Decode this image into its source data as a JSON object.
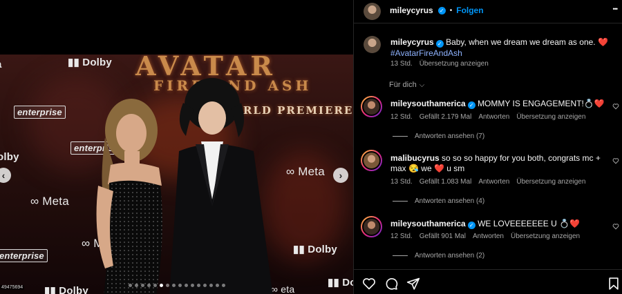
{
  "media": {
    "watermarks": {
      "dolby": "Dolby",
      "meta": "Meta",
      "enterprise": "enterprise",
      "premiere_line1": "AVATAR",
      "premiere_line2": "FIRE AND ASH",
      "premiere_line3": "WORLD PREMIERE"
    },
    "photo_id": "49475694",
    "carousel": {
      "total": 16,
      "active_index": 5
    },
    "prev_label": "‹",
    "next_label": "›"
  },
  "header": {
    "username": "mileycyrus",
    "follow_label": "Folgen",
    "separator": "•",
    "more_label": "•••"
  },
  "caption": {
    "username": "mileycyrus",
    "text": "Baby, when we dream we dream as one.",
    "emoji": "❤️",
    "hashtag": "#AvatarFireAndAsh",
    "time": "13 Std.",
    "translate": "Übersetzung anzeigen"
  },
  "sort": {
    "label": "Für dich",
    "chevron": "⌵"
  },
  "comments": [
    {
      "username": "mileysouthamerica",
      "text": "MOMMY IS ENGAGEMENT!💍❤️",
      "time": "12 Std.",
      "likes": "Gefällt 2.179 Mal",
      "reply": "Antworten",
      "translate": "Übersetzung anzeigen",
      "view_replies": "Antworten ansehen (7)"
    },
    {
      "username": "malibucyrus",
      "text": "so so so happy for you both, congrats mc + max 😪 we ❤️ u sm",
      "time": "13 Std.",
      "likes": "Gefällt 1.083 Mal",
      "reply": "Antworten",
      "translate": "Übersetzung anzeigen",
      "view_replies": "Antworten ansehen (4)"
    },
    {
      "username": "mileysouthamerica",
      "text": "WE LOVEEEEEEE U 💍❤️",
      "time": "12 Std.",
      "likes": "Gefällt 901 Mal",
      "reply": "Antworten",
      "translate": "Übersetzung anzeigen",
      "view_replies": "Antworten ansehen (2)"
    }
  ],
  "colors": {
    "accent": "#0095f6",
    "muted": "#a8a8a8",
    "hashtag": "#8fb3ff"
  }
}
